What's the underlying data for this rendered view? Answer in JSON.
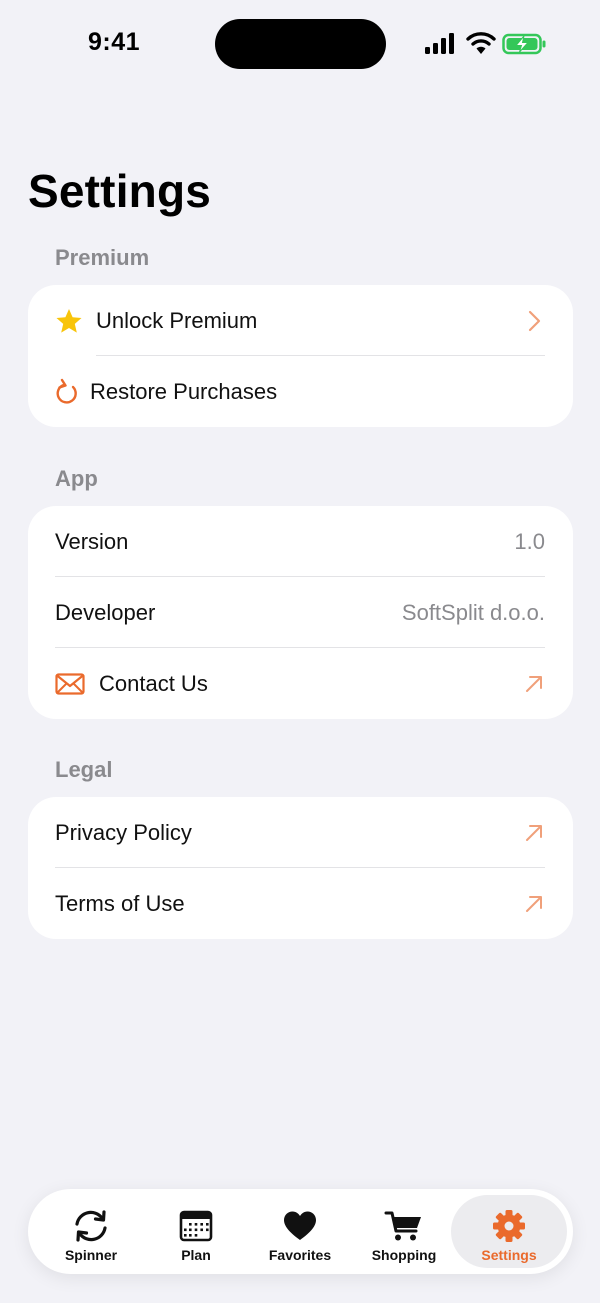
{
  "status_bar": {
    "time": "9:41"
  },
  "title": "Settings",
  "colors": {
    "accent": "#ea6a2c",
    "star": "#f8c40a",
    "battery": "#34c759",
    "background": "#f2f2f7",
    "secondary_text": "#8a8a8e"
  },
  "sections": {
    "premium": {
      "header": "Premium",
      "items": [
        {
          "label": "Unlock Premium",
          "icon": "star-icon",
          "trailing": "chevron-right-icon"
        },
        {
          "label": "Restore Purchases",
          "icon": "restore-icon"
        }
      ]
    },
    "app": {
      "header": "App",
      "items": [
        {
          "label": "Version",
          "value": "1.0"
        },
        {
          "label": "Developer",
          "value": "SoftSplit d.o.o."
        },
        {
          "label": "Contact Us",
          "icon": "mail-icon",
          "trailing": "external-arrow-icon"
        }
      ]
    },
    "legal": {
      "header": "Legal",
      "items": [
        {
          "label": "Privacy Policy",
          "trailing": "external-arrow-icon"
        },
        {
          "label": "Terms of Use",
          "trailing": "external-arrow-icon"
        }
      ]
    }
  },
  "tab_bar": {
    "tabs": [
      {
        "label": "Spinner",
        "icon": "spinner-icon"
      },
      {
        "label": "Plan",
        "icon": "calendar-icon"
      },
      {
        "label": "Favorites",
        "icon": "heart-icon"
      },
      {
        "label": "Shopping",
        "icon": "cart-icon"
      },
      {
        "label": "Settings",
        "icon": "gear-icon",
        "active": true
      }
    ]
  }
}
